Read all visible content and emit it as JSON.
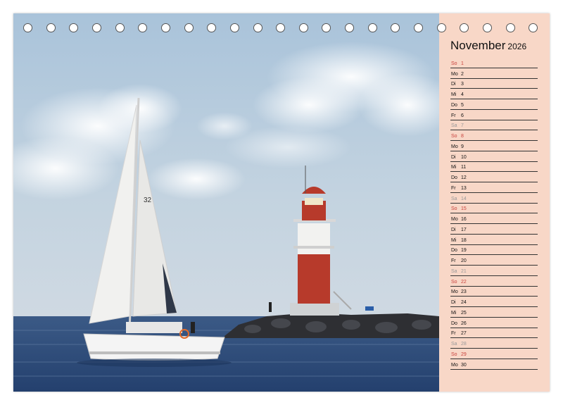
{
  "calendar": {
    "month": "November",
    "year": "2026"
  },
  "days": [
    {
      "wd": "So",
      "d": "1",
      "t": "sun"
    },
    {
      "wd": "Mo",
      "d": "2",
      "t": "wk"
    },
    {
      "wd": "Di",
      "d": "3",
      "t": "wk"
    },
    {
      "wd": "Mi",
      "d": "4",
      "t": "wk"
    },
    {
      "wd": "Do",
      "d": "5",
      "t": "wk"
    },
    {
      "wd": "Fr",
      "d": "6",
      "t": "wk"
    },
    {
      "wd": "Sa",
      "d": "7",
      "t": "sat"
    },
    {
      "wd": "So",
      "d": "8",
      "t": "sun"
    },
    {
      "wd": "Mo",
      "d": "9",
      "t": "wk"
    },
    {
      "wd": "Di",
      "d": "10",
      "t": "wk"
    },
    {
      "wd": "Mi",
      "d": "11",
      "t": "wk"
    },
    {
      "wd": "Do",
      "d": "12",
      "t": "wk"
    },
    {
      "wd": "Fr",
      "d": "13",
      "t": "wk"
    },
    {
      "wd": "Sa",
      "d": "14",
      "t": "sat"
    },
    {
      "wd": "So",
      "d": "15",
      "t": "sun"
    },
    {
      "wd": "Mo",
      "d": "16",
      "t": "wk"
    },
    {
      "wd": "Di",
      "d": "17",
      "t": "wk"
    },
    {
      "wd": "Mi",
      "d": "18",
      "t": "wk"
    },
    {
      "wd": "Do",
      "d": "19",
      "t": "wk"
    },
    {
      "wd": "Fr",
      "d": "20",
      "t": "wk"
    },
    {
      "wd": "Sa",
      "d": "21",
      "t": "sat"
    },
    {
      "wd": "So",
      "d": "22",
      "t": "sun"
    },
    {
      "wd": "Mo",
      "d": "23",
      "t": "wk"
    },
    {
      "wd": "Di",
      "d": "24",
      "t": "wk"
    },
    {
      "wd": "Mi",
      "d": "25",
      "t": "wk"
    },
    {
      "wd": "Do",
      "d": "26",
      "t": "wk"
    },
    {
      "wd": "Fr",
      "d": "27",
      "t": "wk"
    },
    {
      "wd": "Sa",
      "d": "28",
      "t": "sat"
    },
    {
      "wd": "So",
      "d": "29",
      "t": "sun"
    },
    {
      "wd": "Mo",
      "d": "30",
      "t": "wk"
    }
  ],
  "photo": {
    "sail_number": "32"
  },
  "binding": {
    "hole_count": 23
  },
  "colors": {
    "sidebar": "#f8d7c7",
    "sunday": "#c8423c",
    "saturday": "#999999",
    "sky": "#b9cfe0",
    "sea": "#2c4a78",
    "lighthouse_red": "#b73a2b"
  }
}
